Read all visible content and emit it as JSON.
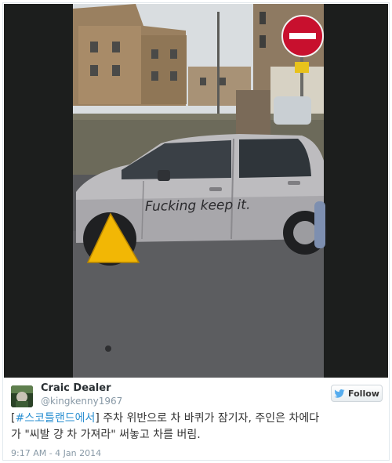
{
  "tweet": {
    "author_name": "Craic Dealer",
    "author_handle": "@kingkenny1967",
    "follow_label": "Follow",
    "text_open_bracket": "[",
    "hashtag": "#스코틀랜드에서",
    "text_line1_rest": "] 주차 위반으로 차 바퀴가 잠기자, 주인은 차에다",
    "text_line2": "가 \"씨발 걍 차 가져라\" 써놓고 차를 버림.",
    "timestamp": "9:17 AM - 4 Jan 2014"
  },
  "photo": {
    "car_graffiti": "Fucking keep it."
  },
  "colors": {
    "hashtag": "#2a8fd1",
    "twitter_bird": "#55acee",
    "clamp": "#f2b705",
    "no_entry_sign": "#c8102e"
  },
  "icons": {
    "follow": "twitter-bird-icon"
  }
}
